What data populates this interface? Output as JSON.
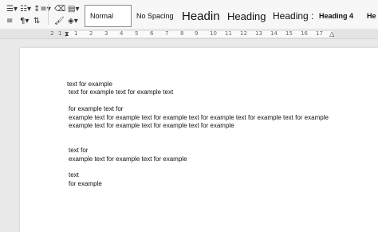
{
  "toolbar": {
    "icons": [
      "list-bullets-icon",
      "list-numbers-icon",
      "list-multilevel-icon",
      "line-spacing-icon",
      "align-justify-icon",
      "paragraph-mark-icon",
      "sort-icon",
      "eraser-icon",
      "format-painter-icon",
      "shading-icon",
      "paint-bucket-icon"
    ]
  },
  "styles": [
    "Normal",
    "No Spacing",
    "Headin",
    "Heading",
    "Heading :",
    "Heading 4",
    "He"
  ],
  "ruler": {
    "numbers": [
      "2",
      "1",
      "1",
      "2",
      "3",
      "4",
      "5",
      "6",
      "7",
      "8",
      "9",
      "10",
      "11",
      "12",
      "13",
      "14",
      "15",
      "16",
      "17"
    ]
  },
  "document": {
    "lines": [
      "text for example",
      "text for example text for example text",
      "for example text for",
      "example text for example text for example text for example text for example text for example",
      "example text for example text for example text for example",
      "text for",
      "example text for example text for example",
      "text",
      "for example"
    ]
  },
  "colors": {
    "ribbon": "#f7f7f7",
    "workspace": "#e9e9e9",
    "page": "#ffffff"
  }
}
